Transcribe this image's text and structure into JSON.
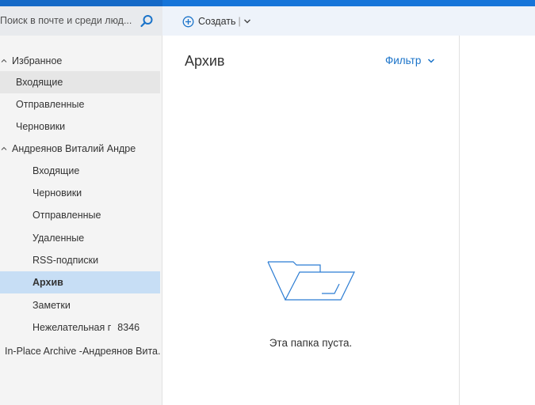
{
  "search": {
    "placeholder_text": "Поиск в почте и среди люд..."
  },
  "toolbar": {
    "create_label": "Создать",
    "separator": "|"
  },
  "sidebar": {
    "favorites": {
      "header": "Избранное",
      "items": [
        {
          "label": "Входящие"
        },
        {
          "label": "Отправленные"
        },
        {
          "label": "Черновики"
        }
      ]
    },
    "account": {
      "header": "Андреянов Виталий Андре",
      "items": [
        {
          "label": "Входящие"
        },
        {
          "label": "Черновики"
        },
        {
          "label": "Отправленные"
        },
        {
          "label": "Удаленные"
        },
        {
          "label": "RSS-подписки"
        },
        {
          "label": "Архив"
        },
        {
          "label": "Заметки"
        },
        {
          "label": "Нежелательная г",
          "count": "8346"
        }
      ]
    },
    "archive_mailbox": {
      "label": "In-Place Archive -Андреянов Вита..."
    }
  },
  "main": {
    "folder_title": "Архив",
    "filter_label": "Фильтр",
    "empty_message": "Эта папка пуста."
  },
  "colors": {
    "accent": "#1a73c9",
    "selected_bg": "#c7def5",
    "sidebar_bg": "#f4f4f4",
    "toolbar_bg": "#eef3fa"
  }
}
